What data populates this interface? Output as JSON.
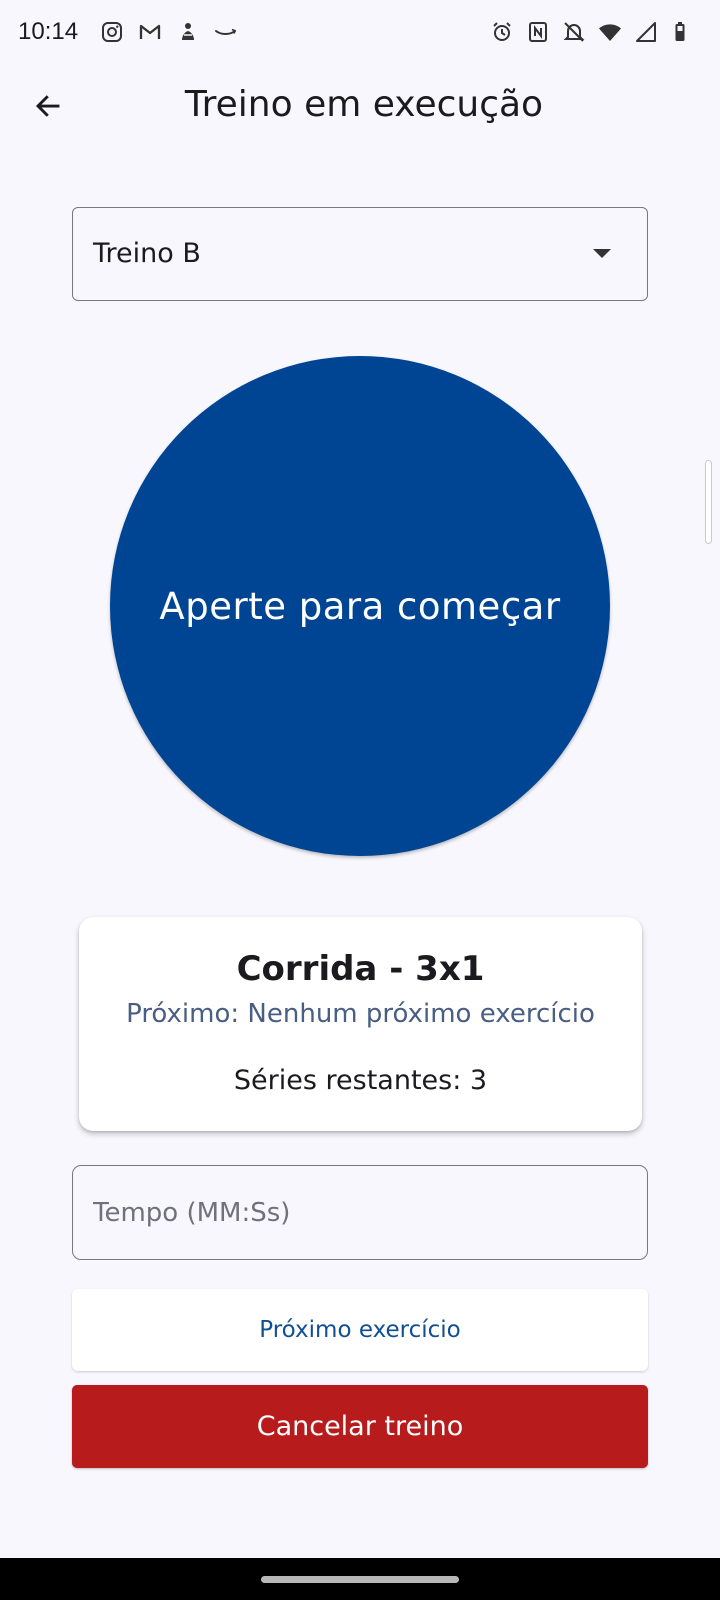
{
  "status_bar": {
    "time": "10:14",
    "left_icons": [
      "instagram-icon",
      "gmail-icon",
      "app-icon",
      "amazon-icon"
    ],
    "right_icons": [
      "alarm-icon",
      "nfc-icon",
      "mute-icon",
      "wifi-icon",
      "signal-icon",
      "battery-icon"
    ]
  },
  "app_bar": {
    "title": "Treino em execução",
    "back_icon": "arrow-back-icon"
  },
  "workout_select": {
    "selected": "Treino B",
    "arrow_icon": "dropdown-arrow-icon"
  },
  "start_button": {
    "label": "Aperte para começar",
    "color": "#004593"
  },
  "exercise_card": {
    "title": "Corrida - 3x1",
    "next": "Próximo: Nenhum próximo exercício",
    "series_remaining": "Séries restantes: 3"
  },
  "time_input": {
    "placeholder": "Tempo (MM:Ss)",
    "value": ""
  },
  "actions": {
    "next_label": "Próximo exercício",
    "cancel_label": "Cancelar treino",
    "cancel_color": "#b71b1c"
  }
}
